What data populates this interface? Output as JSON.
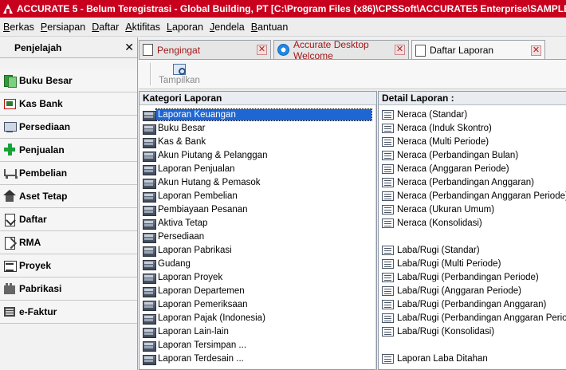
{
  "window": {
    "title": "ACCURATE 5  - Belum Teregistrasi - Global Building, PT   [C:\\Program Files (x86)\\CPSSoft\\ACCURATE5 Enterprise\\SAMPLE\\SAI"
  },
  "menu": [
    {
      "label": "Berkas"
    },
    {
      "label": "Persiapan"
    },
    {
      "label": "Daftar"
    },
    {
      "label": "Aktifitas"
    },
    {
      "label": "Laporan"
    },
    {
      "label": "Jendela"
    },
    {
      "label": "Bantuan"
    }
  ],
  "sidebar": {
    "title": "Penjelajah",
    "close": "✕",
    "items": [
      {
        "label": "Buku Besar",
        "icon": "book-icon"
      },
      {
        "label": "Kas Bank",
        "icon": "cash-bank-icon"
      },
      {
        "label": "Persediaan",
        "icon": "monitor-icon"
      },
      {
        "label": "Penjualan",
        "icon": "plus-icon"
      },
      {
        "label": "Pembelian",
        "icon": "cart-icon"
      },
      {
        "label": "Aset Tetap",
        "icon": "house-icon"
      },
      {
        "label": "Daftar",
        "icon": "checklist-icon"
      },
      {
        "label": "RMA",
        "icon": "return-icon"
      },
      {
        "label": "Proyek",
        "icon": "project-icon"
      },
      {
        "label": "Pabrikasi",
        "icon": "factory-icon"
      },
      {
        "label": "e-Faktur",
        "icon": "invoice-icon"
      }
    ]
  },
  "tabs": [
    {
      "label": "Pengingat",
      "close": "✕"
    },
    {
      "label": "Accurate Desktop Welcome",
      "close": "✕"
    },
    {
      "label": "Daftar Laporan",
      "close": "✕"
    }
  ],
  "toolbar": {
    "show_label": "Tampilkan"
  },
  "categories": {
    "header": "Kategori Laporan",
    "items": [
      "Laporan Keuangan",
      "Buku Besar",
      "Kas & Bank",
      "Akun Piutang & Pelanggan",
      "Laporan Penjualan",
      "Akun Hutang & Pemasok",
      "Laporan Pembelian",
      "Pembiayaan Pesanan",
      "Aktiva Tetap",
      "Persediaan",
      "Laporan Pabrikasi",
      "Gudang",
      "Laporan Proyek",
      "Laporan Departemen",
      "Laporan Pemeriksaan",
      "Laporan Pajak (Indonesia)",
      "Laporan Lain-lain",
      "Laporan Tersimpan ...",
      "Laporan Terdesain ..."
    ],
    "selected": "Laporan Keuangan"
  },
  "details": {
    "header": "Detail Laporan :",
    "items": [
      "Neraca (Standar)",
      "Neraca (Induk Skontro)",
      "Neraca (Multi Periode)",
      "Neraca (Perbandingan Bulan)",
      "Neraca (Anggaran Periode)",
      "Neraca (Perbandingan Anggaran)",
      "Neraca (Perbandingan Anggaran Periode)",
      "Neraca (Ukuran Umum)",
      "Neraca (Konsolidasi)",
      "",
      "Laba/Rugi (Standar)",
      "Laba/Rugi (Multi Periode)",
      "Laba/Rugi (Perbandingan Periode)",
      "Laba/Rugi (Anggaran Periode)",
      "Laba/Rugi (Perbandingan Anggaran)",
      "Laba/Rugi (Perbandingan Anggaran Periode)",
      "Laba/Rugi (Konsolidasi)",
      "",
      "Laporan Laba Ditahan"
    ]
  }
}
